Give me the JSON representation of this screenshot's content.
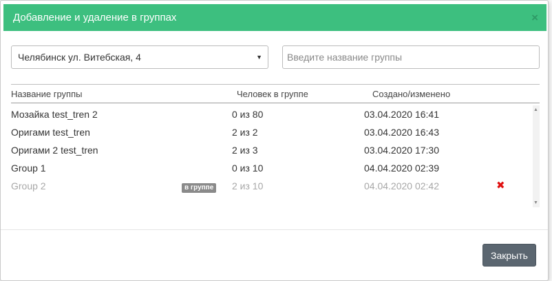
{
  "modal": {
    "title": "Добавление и удаление в группах",
    "close_icon": "×"
  },
  "form": {
    "selected_location": "Челябинск ул. Витебская, 4",
    "group_name_placeholder": "Введите название группы"
  },
  "table": {
    "headers": {
      "name": "Название группы",
      "members": "Человек в группе",
      "modified": "Создано/изменено"
    },
    "rows": [
      {
        "name": "Мозайка test_tren 2",
        "members": "0 из 80",
        "modified": "03.04.2020 16:41"
      },
      {
        "name": "Оригами test_tren",
        "members": "2 из 2",
        "modified": "03.04.2020 16:43"
      },
      {
        "name": "Оригами 2 test_tren",
        "members": "2 из 3",
        "modified": "03.04.2020 17:30"
      },
      {
        "name": "Group 1",
        "members": "0 из 10",
        "modified": "04.04.2020 02:39"
      },
      {
        "name": "Group 2",
        "members": "2 из 10",
        "modified": "04.04.2020 02:42",
        "badge": "в группе",
        "remove_icon": "✖"
      }
    ]
  },
  "footer": {
    "close_label": "Закрыть"
  },
  "colors": {
    "header": "#3dbf7f",
    "remove": "#e01010",
    "button": "#5b6670"
  }
}
